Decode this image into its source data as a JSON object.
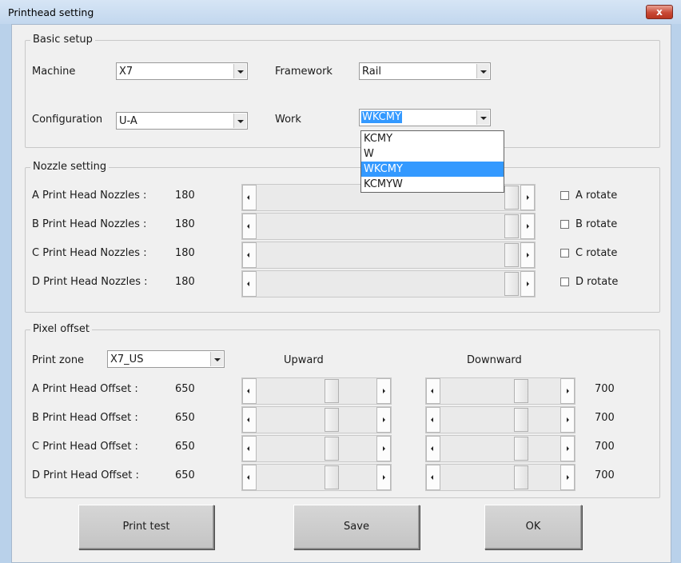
{
  "window": {
    "title": "Printhead setting",
    "close_glyph": "x"
  },
  "basic_setup": {
    "legend": "Basic setup",
    "machine": {
      "label": "Machine",
      "value": "X7"
    },
    "framework": {
      "label": "Framework",
      "value": "Rail"
    },
    "configuration": {
      "label": "Configuration",
      "value": "U-A"
    },
    "work": {
      "label": "Work",
      "value": "WKCMY",
      "options": [
        "KCMY",
        "W",
        "WKCMY",
        "KCMYW"
      ],
      "highlighted_option": "WKCMY"
    }
  },
  "nozzle_setting": {
    "legend": "Nozzle setting",
    "rows": [
      {
        "label": "A Print Head Nozzles :",
        "value": "180",
        "rotate_label": "A rotate",
        "checked": false
      },
      {
        "label": "B Print Head Nozzles :",
        "value": "180",
        "rotate_label": "B rotate",
        "checked": false
      },
      {
        "label": "C Print Head Nozzles :",
        "value": "180",
        "rotate_label": "C rotate",
        "checked": false
      },
      {
        "label": "D Print Head Nozzles :",
        "value": "180",
        "rotate_label": "D rotate",
        "checked": false
      }
    ]
  },
  "pixel_offset": {
    "legend": "Pixel offset",
    "print_zone": {
      "label": "Print zone",
      "value": "X7_US"
    },
    "upward_header": "Upward",
    "downward_header": "Downward",
    "rows": [
      {
        "label": "A Print Head Offset :",
        "upward_value": "650",
        "downward_value": "700"
      },
      {
        "label": "B Print Head Offset :",
        "upward_value": "650",
        "downward_value": "700"
      },
      {
        "label": "C Print Head Offset :",
        "upward_value": "650",
        "downward_value": "700"
      },
      {
        "label": "D Print Head Offset :",
        "upward_value": "650",
        "downward_value": "700"
      }
    ]
  },
  "buttons": {
    "print_test": "Print test",
    "save": "Save",
    "ok": "OK"
  },
  "colors": {
    "title_bar": "#c2d7ee",
    "close_button": "#c94a36",
    "selection": "#3399ff",
    "window_bg": "#f0f0f0"
  }
}
